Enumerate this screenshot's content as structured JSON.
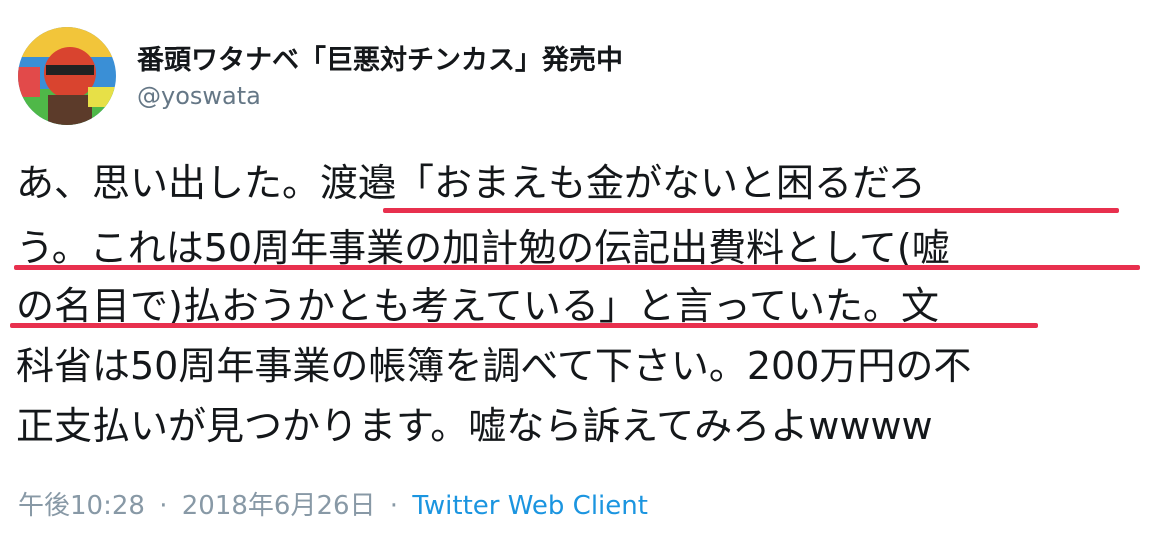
{
  "tweet": {
    "author": {
      "display_name": "番頭ワタナベ「巨悪対チンカス」発売中",
      "handle": "@yoswata"
    },
    "text_lines": [
      "あ、思い出した。渡邉「おまえも金がないと困るだろ",
      "う。これは50周年事業の加計勉の伝記出費料として(嘘",
      "の名目で)払おうかとも考えている」と言っていた。文",
      "科省は50周年事業の帳簿を調べて下さい。200万円の不",
      "正支払いが見つかります。嘘なら訴えてみろよwwww"
    ],
    "timestamp": "午後10:28",
    "date": "2018年6月26日",
    "separator": "·",
    "client": "Twitter Web Client"
  },
  "colors": {
    "underline": "#e8304e",
    "client_link": "#1b95e0",
    "meta": "#8899a6",
    "handle": "#657786"
  },
  "icons": {
    "avatar": "user-avatar-photo"
  }
}
